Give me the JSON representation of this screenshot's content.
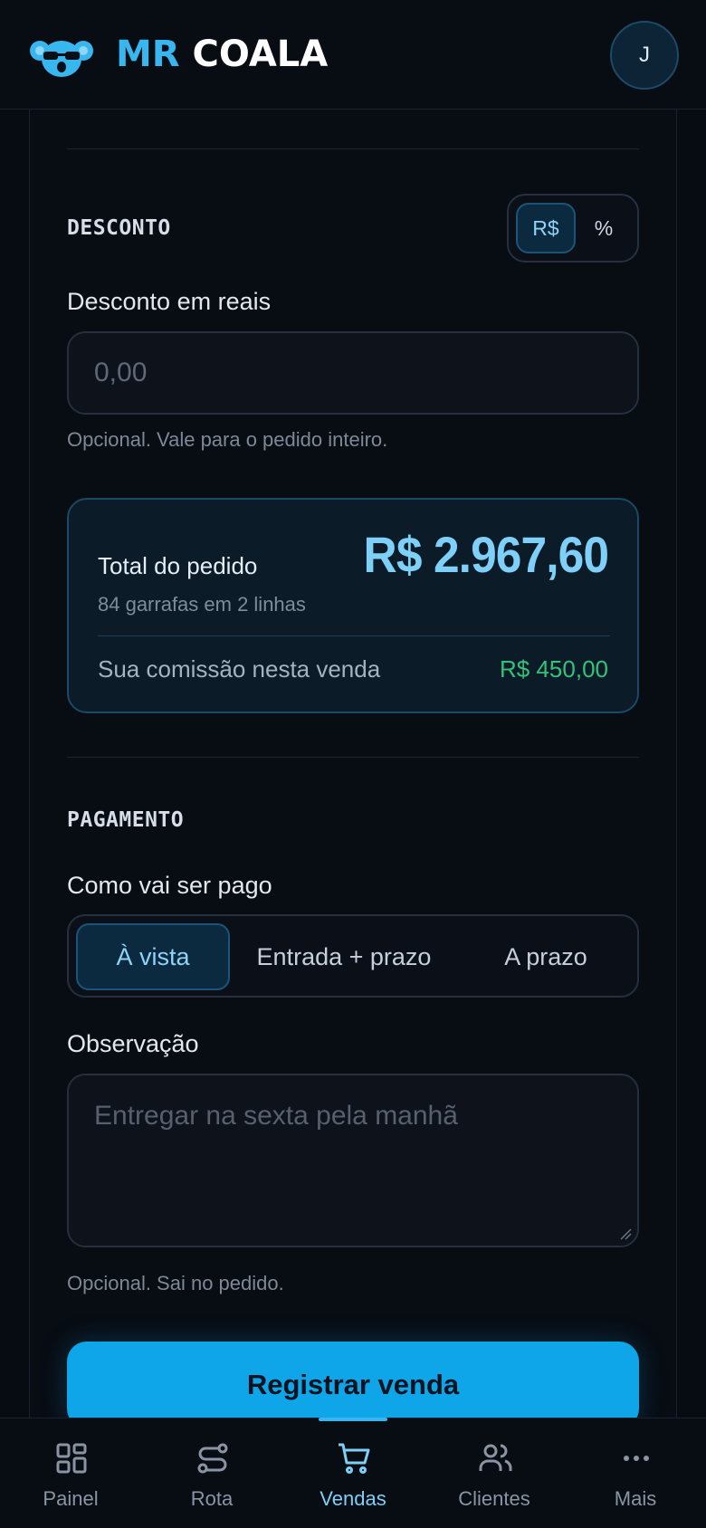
{
  "header": {
    "brand_mr": "MR",
    "brand_coala": "COALA",
    "avatar_initial": "J"
  },
  "discount": {
    "section_title": "DESCONTO",
    "mode_currency": "R$",
    "mode_percent": "%",
    "field_label": "Desconto em reais",
    "placeholder": "0,00",
    "hint": "Opcional. Vale para o pedido inteiro."
  },
  "summary": {
    "total_label": "Total do pedido",
    "total_value": "R$ 2.967,60",
    "subtitle": "84 garrafas em 2 linhas",
    "commission_label": "Sua comissão nesta venda",
    "commission_value": "R$ 450,00"
  },
  "payment": {
    "section_title": "PAGAMENTO",
    "field_label": "Como vai ser pago",
    "options": [
      "À vista",
      "Entrada + prazo",
      "A prazo"
    ],
    "selected": "À vista"
  },
  "note": {
    "label": "Observação",
    "placeholder": "Entregar na sexta pela manhã",
    "hint": "Opcional. Sai no pedido."
  },
  "submit_label": "Registrar venda",
  "nav": {
    "items": [
      {
        "label": "Painel",
        "icon": "grid-icon"
      },
      {
        "label": "Rota",
        "icon": "route-icon"
      },
      {
        "label": "Vendas",
        "icon": "cart-icon"
      },
      {
        "label": "Clientes",
        "icon": "users-icon"
      },
      {
        "label": "Mais",
        "icon": "more-icon"
      }
    ],
    "active": "Vendas"
  },
  "colors": {
    "accent": "#0ea5e9",
    "brand_blue": "#38b6f0",
    "commission_green": "#32c27a",
    "background": "#070b12"
  }
}
